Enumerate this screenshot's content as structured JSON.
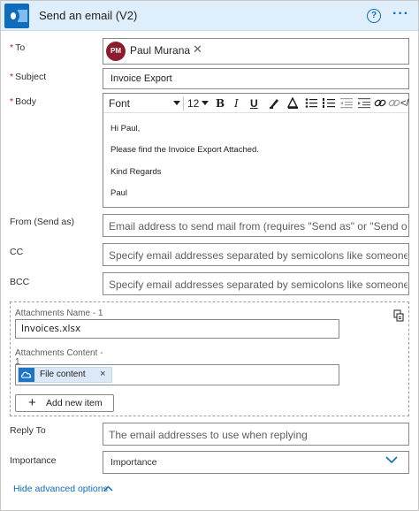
{
  "header": {
    "title": "Send an email (V2)",
    "help_glyph": "?",
    "more_glyph": "···"
  },
  "to": {
    "label": "To",
    "required": "*",
    "recipient_initials": "PM",
    "recipient_name": "Paul Murana",
    "remove_glyph": "✕"
  },
  "subject": {
    "label": "Subject",
    "required": "*",
    "value": "Invoice Export"
  },
  "body": {
    "label": "Body",
    "required": "*",
    "font": "Font",
    "font_size": "12",
    "lines": [
      "Hi Paul,",
      "Please find the Invoice Export Attached.",
      "Kind Regards",
      "Paul"
    ]
  },
  "from": {
    "label": "From (Send as)",
    "placeholder": "Email address to send mail from (requires \"Send as\" or \"Send on beha"
  },
  "cc": {
    "label": "CC",
    "placeholder": "Specify email addresses separated by semicolons like someone@con"
  },
  "bcc": {
    "label": "BCC",
    "placeholder": "Specify email addresses separated by semicolons like someone@con"
  },
  "attachments": {
    "name_label": "Attachments Name - 1",
    "name_value": "Invoices.xlsx",
    "content_label_line1": "Attachments Content -",
    "content_label_line2": "1",
    "content_token": "File content",
    "remove_glyph": "×",
    "add_button": "Add new item",
    "add_glyph": "+"
  },
  "reply_to": {
    "label": "Reply To",
    "placeholder": "The email addresses to use when replying"
  },
  "importance": {
    "label": "Importance",
    "selected": "Importance"
  },
  "footer": {
    "hide_advanced": "Hide advanced options"
  },
  "colors": {
    "accent": "#0f6cbd",
    "header_bg": "#dfeefb",
    "avatar_bg": "#8c1d2e",
    "required": "#a4262c"
  }
}
